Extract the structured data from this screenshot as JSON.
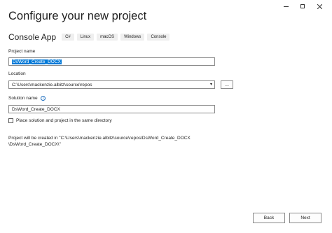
{
  "window": {
    "minimize": "—",
    "maximize": "☐",
    "close": "✕"
  },
  "header": {
    "title": "Configure your new project"
  },
  "template": {
    "name": "Console App",
    "tags": [
      "C#",
      "Linux",
      "macOS",
      "Windows",
      "Console"
    ]
  },
  "project_name": {
    "label": "Project name",
    "value": "DsWord_Create_DOCX"
  },
  "location": {
    "label": "Location",
    "value": "C:\\Users\\mackenzie.albitz\\source\\repos",
    "browse_label": "..."
  },
  "solution_name": {
    "label": "Solution name",
    "value": "DsWord_Create_DOCX",
    "info_icon": "info-icon"
  },
  "options": {
    "same_directory_label": "Place solution and project in the same directory",
    "same_directory_checked": false
  },
  "note": {
    "line1": "Project will be created in \"C:\\Users\\mackenzie.albitz\\source\\repos\\DsWord_Create_DOCX",
    "line2": "\\DsWord_Create_DOCX\\\""
  },
  "footer": {
    "back_label": "Back",
    "next_label": "Next"
  }
}
